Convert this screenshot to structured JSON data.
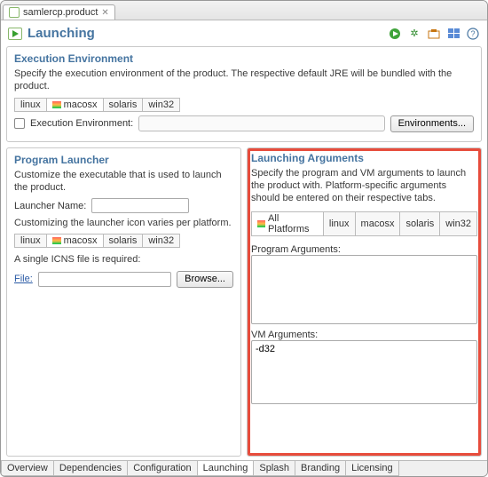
{
  "file_tab": {
    "label": "samlercp.product"
  },
  "page": {
    "title": "Launching"
  },
  "exec_env": {
    "title": "Execution Environment",
    "desc": "Specify the execution environment of the product. The respective default JRE will be bundled with the product.",
    "tabs": [
      "linux",
      "macosx",
      "solaris",
      "win32"
    ],
    "selected": "macosx",
    "checkbox_label": "Execution Environment:",
    "button": "Environments..."
  },
  "launcher": {
    "title": "Program Launcher",
    "desc": "Customize the executable that is used to launch the product.",
    "name_label": "Launcher Name:",
    "name_value": "",
    "icon_note": "Customizing the launcher icon varies per platform.",
    "tabs": [
      "linux",
      "macosx",
      "solaris",
      "win32"
    ],
    "selected": "macosx",
    "icns_note": "A single ICNS file is required:",
    "file_label": "File:",
    "file_value": "",
    "browse": "Browse..."
  },
  "args": {
    "title": "Launching Arguments",
    "desc": "Specify the program and VM arguments to launch the product with.  Platform-specific arguments should be entered on their respective tabs.",
    "tabs": [
      "All Platforms",
      "linux",
      "macosx",
      "solaris",
      "win32"
    ],
    "selected": "All Platforms",
    "program_label": "Program Arguments:",
    "program_value": "",
    "vm_label": "VM Arguments:",
    "vm_value": "-d32"
  },
  "bottom_tabs": {
    "tabs": [
      "Overview",
      "Dependencies",
      "Configuration",
      "Launching",
      "Splash",
      "Branding",
      "Licensing"
    ],
    "selected": "Launching"
  },
  "icons": {
    "run": "▶",
    "debug_launch": "✲",
    "export": "▣",
    "views": "☰",
    "help": "?"
  }
}
